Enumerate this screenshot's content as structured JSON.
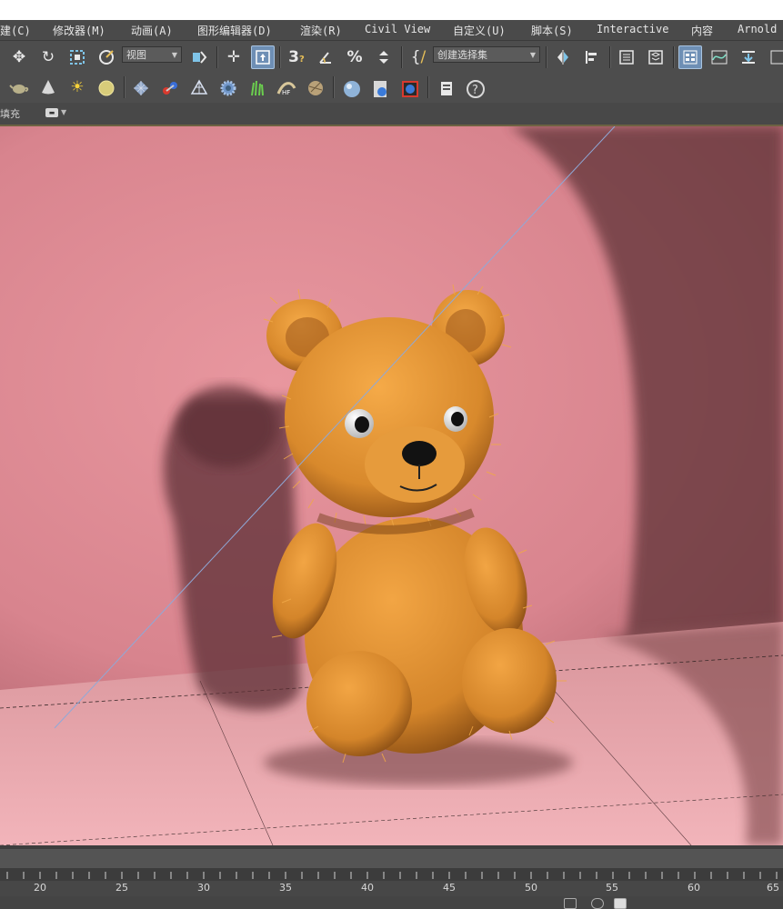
{
  "menubar": {
    "items": [
      "建(C)",
      "修改器(M)",
      "动画(A)",
      "图形编辑器(D)",
      "渲染(R)",
      "Civil View",
      "自定义(U)",
      "脚本(S)",
      "Interactive",
      "内容",
      "Arnold"
    ]
  },
  "toolbar": {
    "view_dropdown": "视图",
    "selection_set_dropdown": "创建选择集"
  },
  "ribbon": {
    "label": "填充"
  },
  "timeline": {
    "ticks": [
      "20",
      "25",
      "30",
      "35",
      "40",
      "45",
      "50",
      "55",
      "60",
      "65"
    ]
  },
  "colors": {
    "wall": "#e0909a",
    "floor": "#e8a8ae",
    "bear": "#d9892e",
    "toolbar_bg": "#4d4d4d",
    "active_button": "#6e8fb5"
  },
  "icons": [
    "move-icon",
    "rotate-icon",
    "select-region-icon",
    "select-link-icon",
    "view-dropdown",
    "snap-icon",
    "pan-icon",
    "select-object-icon",
    "snap-3d-icon",
    "angle-snap-icon",
    "percent-snap-icon",
    "spinner-snap-icon",
    "edit-named-selection-icon",
    "mirror-icon",
    "align-icon",
    "layer-explorer-icon",
    "layer-manager-icon",
    "scene-explorer-icon",
    "curve-editor-icon",
    "schematic-view-icon",
    "teapot-icon",
    "cone-icon",
    "sun-icon",
    "sphere-light-icon",
    "grid-material-icon",
    "bone-icon",
    "mesh-icon",
    "gear-icon",
    "grass-icon",
    "hair-icon",
    "fabric-icon",
    "render-sphere-icon",
    "render-setup-icon",
    "render-frame-icon",
    "clipboard-icon",
    "help-icon"
  ]
}
